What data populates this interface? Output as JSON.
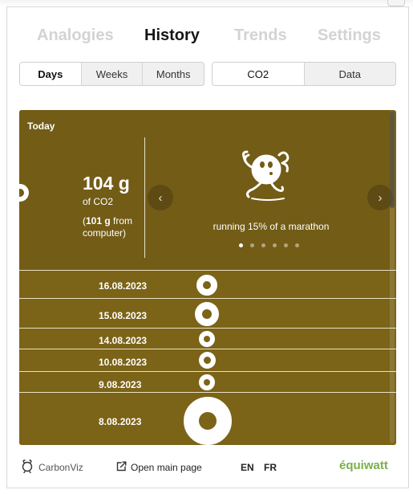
{
  "main_tabs": [
    {
      "label": "Analogies",
      "active": false
    },
    {
      "label": "History",
      "active": true
    },
    {
      "label": "Trends",
      "active": false
    },
    {
      "label": "Settings",
      "active": false
    }
  ],
  "period_tabs": [
    {
      "label": "Days",
      "active": true
    },
    {
      "label": "Weeks",
      "active": false
    },
    {
      "label": "Months",
      "active": false
    }
  ],
  "mode_tabs": [
    {
      "label": "CO2",
      "active": true
    },
    {
      "label": "Data",
      "active": false
    }
  ],
  "today": {
    "label": "Today",
    "amount": "104 g",
    "unit": "of CO2",
    "detail_open": "(",
    "detail_value": "101 g",
    "detail_rest": " from computer)",
    "analogy": "running 15% of a marathon",
    "carousel_pages": 6,
    "carousel_active": 0
  },
  "history": [
    {
      "date": "16.08.2023"
    },
    {
      "date": "15.08.2023"
    },
    {
      "date": "14.08.2023"
    },
    {
      "date": "10.08.2023"
    },
    {
      "date": "9.08.2023"
    },
    {
      "date": "8.08.2023"
    }
  ],
  "footer": {
    "logo": "CarbonViz",
    "open_link": "Open main page",
    "lang_en": "EN",
    "lang_fr": "FR",
    "brand": "équiwatt"
  },
  "colors": {
    "panel": "#7b6318",
    "today_panel": "#725c16",
    "brand_green": "#7bb04a"
  },
  "icons": {
    "runner": "running-earth-icon",
    "prev": "chevron-left-icon",
    "next": "chevron-right-icon",
    "logo": "carbonviz-logo-icon",
    "open": "external-link-icon"
  }
}
